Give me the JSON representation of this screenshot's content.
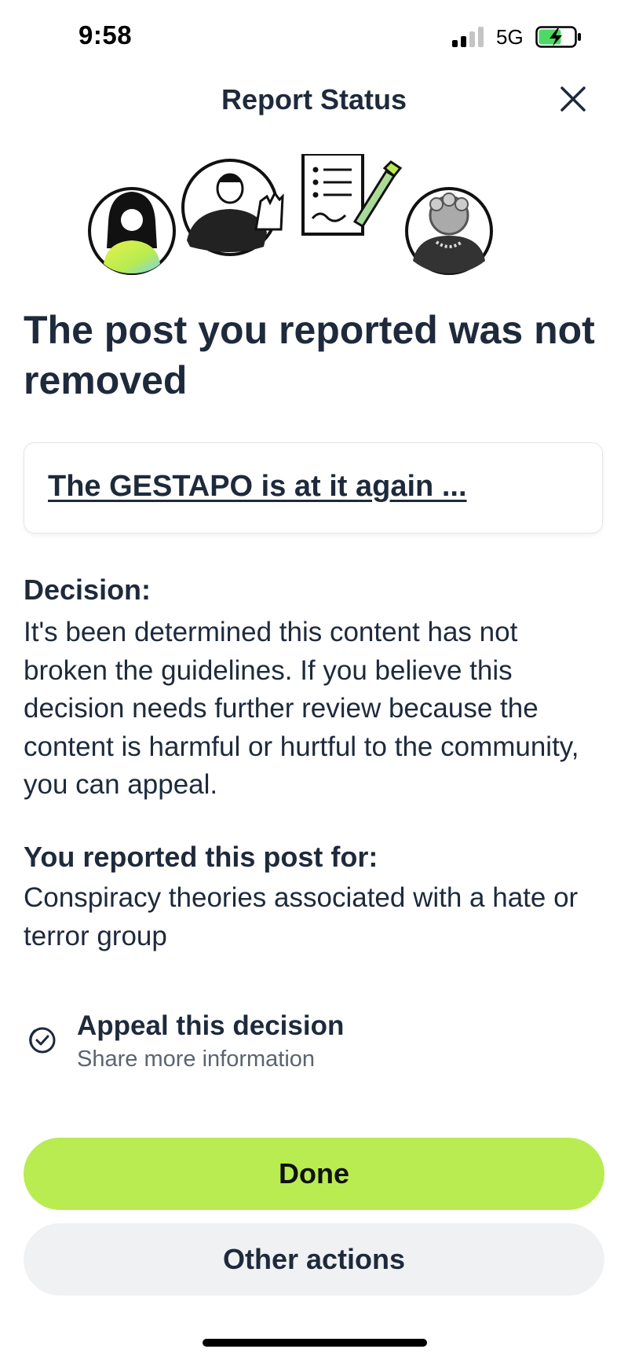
{
  "status_bar": {
    "time": "9:58",
    "network": "5G",
    "battery_charging": true,
    "battery_color": "#4cd964"
  },
  "header": {
    "title": "Report Status",
    "close_icon": "close-icon"
  },
  "headline": "The post you reported was not removed",
  "post": {
    "title": "The GESTAPO is at it again ..."
  },
  "decision": {
    "label": "Decision:",
    "text": "It's been determined this content has not broken the guidelines. If you believe this decision needs further review because the content is harmful or hurtful to the community, you can appeal."
  },
  "reason": {
    "label": "You reported this post for:",
    "text": "Conspiracy theories associated with a hate or terror group"
  },
  "appeal": {
    "icon": "check-badge-icon",
    "title": "Appeal this decision",
    "subtitle": "Share more information"
  },
  "buttons": {
    "done": "Done",
    "other_actions": "Other actions"
  },
  "colors": {
    "accent": "#b8ec50",
    "text": "#1e2a3c",
    "secondary_button": "#f0f1f3"
  }
}
